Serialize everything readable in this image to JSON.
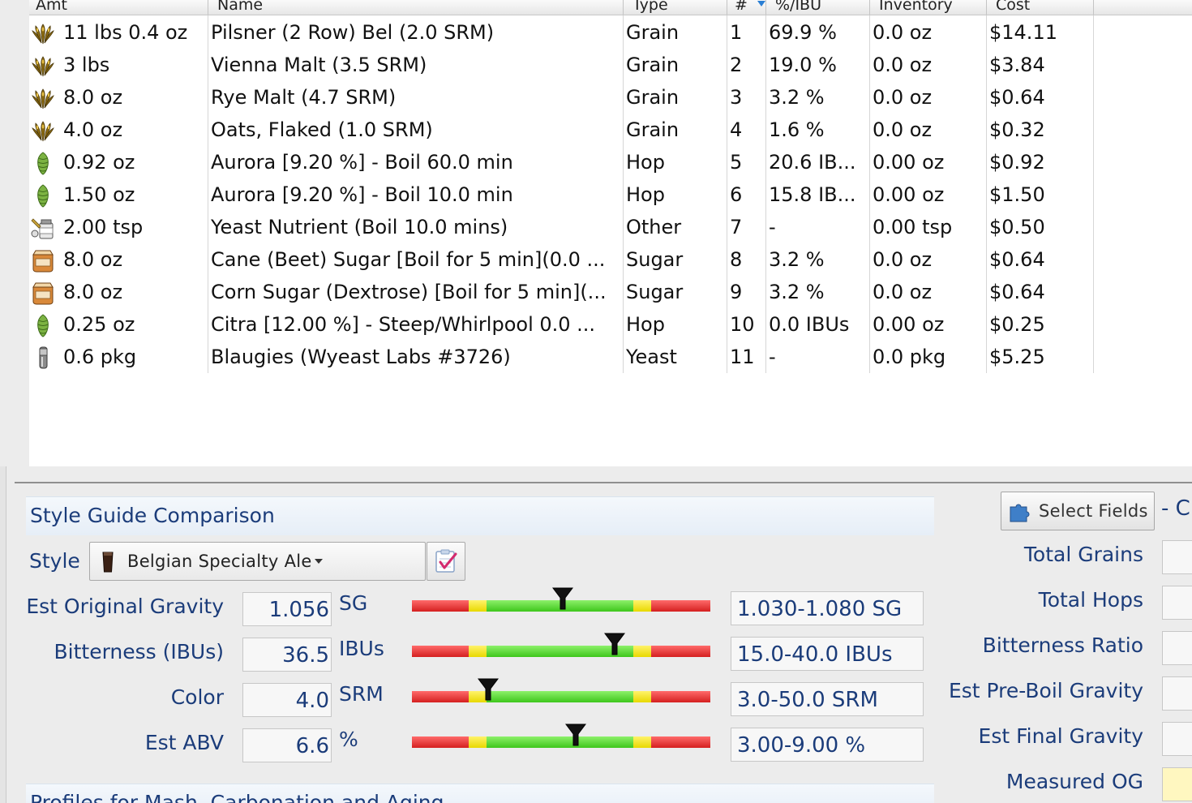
{
  "table": {
    "headers": [
      "Amt",
      "Name",
      "Type",
      "#",
      "%/IBU",
      "Inventory",
      "Cost"
    ],
    "rows": [
      {
        "icon": "grain-icon",
        "amt": "11 lbs 0.4 oz",
        "name": "Pilsner (2 Row) Bel (2.0 SRM)",
        "type": "Grain",
        "num": "1",
        "pct": "69.9 %",
        "inv": "0.0 oz",
        "cost": "$14.11"
      },
      {
        "icon": "grain-icon",
        "amt": "3 lbs",
        "name": "Vienna Malt (3.5 SRM)",
        "type": "Grain",
        "num": "2",
        "pct": "19.0 %",
        "inv": "0.0 oz",
        "cost": "$3.84"
      },
      {
        "icon": "grain-icon",
        "amt": "8.0 oz",
        "name": "Rye Malt (4.7 SRM)",
        "type": "Grain",
        "num": "3",
        "pct": "3.2 %",
        "inv": "0.0 oz",
        "cost": "$0.64"
      },
      {
        "icon": "grain-icon",
        "amt": "4.0 oz",
        "name": "Oats, Flaked (1.0 SRM)",
        "type": "Grain",
        "num": "4",
        "pct": "1.6 %",
        "inv": "0.0 oz",
        "cost": "$0.32"
      },
      {
        "icon": "hop-icon",
        "amt": "0.92 oz",
        "name": "Aurora [9.20 %] - Boil 60.0 min",
        "type": "Hop",
        "num": "5",
        "pct": "20.6 IB...",
        "inv": "0.00 oz",
        "cost": "$0.92"
      },
      {
        "icon": "hop-icon",
        "amt": "1.50 oz",
        "name": "Aurora [9.20 %] - Boil 10.0 min",
        "type": "Hop",
        "num": "6",
        "pct": "15.8 IB...",
        "inv": "0.00 oz",
        "cost": "$1.50"
      },
      {
        "icon": "other-icon",
        "amt": "2.00 tsp",
        "name": "Yeast Nutrient (Boil 10.0 mins)",
        "type": "Other",
        "num": "7",
        "pct": "-",
        "inv": "0.00 tsp",
        "cost": "$0.50"
      },
      {
        "icon": "sugar-icon",
        "amt": "8.0 oz",
        "name": "Cane (Beet) Sugar [Boil for 5 min](0.0 ...",
        "type": "Sugar",
        "num": "8",
        "pct": "3.2 %",
        "inv": "0.0 oz",
        "cost": "$0.64"
      },
      {
        "icon": "sugar-icon",
        "amt": "8.0 oz",
        "name": "Corn Sugar (Dextrose) [Boil for 5 min](...",
        "type": "Sugar",
        "num": "9",
        "pct": "3.2 %",
        "inv": "0.0 oz",
        "cost": "$0.64"
      },
      {
        "icon": "hop-icon",
        "amt": "0.25 oz",
        "name": "Citra [12.00 %] - Steep/Whirlpool  0.0 ...",
        "type": "Hop",
        "num": "10",
        "pct": "0.0 IBUs",
        "inv": "0.00 oz",
        "cost": "$0.25"
      },
      {
        "icon": "yeast-icon",
        "amt": "0.6 pkg",
        "name": "Blaugies (Wyeast Labs #3726)",
        "type": "Yeast",
        "num": "11",
        "pct": "-",
        "inv": "0.0 pkg",
        "cost": "$5.25"
      }
    ]
  },
  "style_guide": {
    "title": "Style Guide Comparison",
    "style_label": "Style",
    "style_value": "Belgian Specialty Ale",
    "rows": [
      {
        "label": "Est Original Gravity",
        "value": "1.056",
        "unit": "SG",
        "range": "1.030-1.080 SG",
        "marker_fraction": 0.505
      },
      {
        "label": "Bitterness (IBUs)",
        "value": "36.5",
        "unit": "IBUs",
        "range": "15.0-40.0 IBUs",
        "marker_fraction": 0.68
      },
      {
        "label": "Color",
        "value": "4.0",
        "unit": "SRM",
        "range": "3.0-50.0 SRM",
        "marker_fraction": 0.255
      },
      {
        "label": "Est ABV",
        "value": "6.6",
        "unit": "%",
        "range": "3.00-9.00 %",
        "marker_fraction": 0.55
      }
    ]
  },
  "profiles": {
    "title": "Profiles for Mash, Carbonation and Aging"
  },
  "right_panel": {
    "select_fields_label": "Select Fields",
    "dash_label": "- C",
    "labels": [
      "Total Grains",
      "Total Hops",
      "Bitterness Ratio",
      "Est Pre-Boil Gravity",
      "Est Final Gravity",
      "Measured OG"
    ]
  },
  "colors": {
    "label_blue": "#1b3c7a",
    "gauge_red": "#e53030",
    "gauge_yellow": "#f2e200",
    "gauge_green": "#56d42a"
  }
}
